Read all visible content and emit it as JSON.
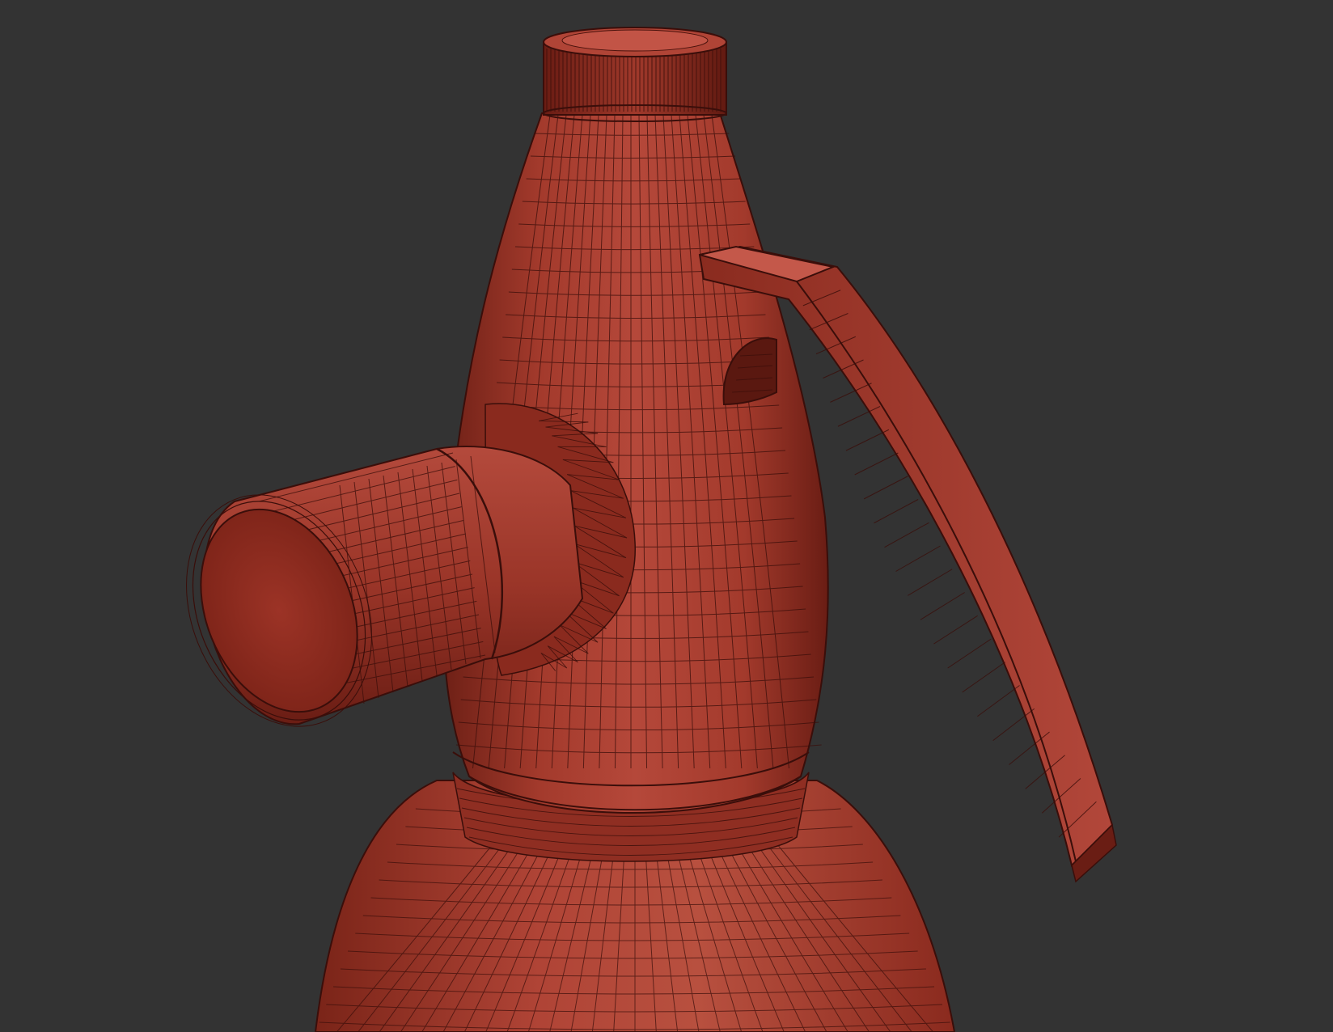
{
  "scene": {
    "subject": "siphon-bottle-head-wireframe",
    "colors": {
      "background": "#333333",
      "base": "#a33a2c",
      "mid": "#8f2e22",
      "dark": "#5e1a12",
      "light": "#c4584a",
      "wire": "#3a0e0a"
    }
  }
}
